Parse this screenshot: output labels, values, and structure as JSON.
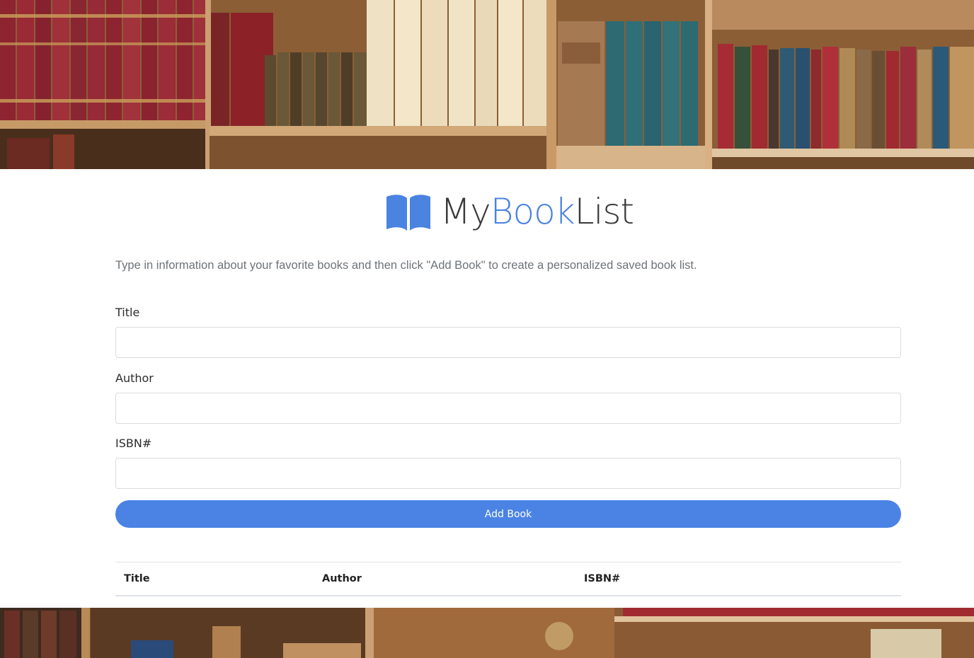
{
  "app": {
    "logo": {
      "word1": "My",
      "word2": "Book",
      "word3": "List",
      "icon": "open-book-icon",
      "accent_color": "#4a83e0"
    },
    "intro": "Type in information about your favorite books and then click \"Add Book\" to create a personalized saved book list."
  },
  "form": {
    "title_label": "Title",
    "title_value": "",
    "author_label": "Author",
    "author_value": "",
    "isbn_label": "ISBN#",
    "isbn_value": "",
    "submit_label": "Add Book",
    "button_color": "#4a83e4"
  },
  "table": {
    "columns": [
      "Title",
      "Author",
      "ISBN#"
    ],
    "rows": []
  }
}
